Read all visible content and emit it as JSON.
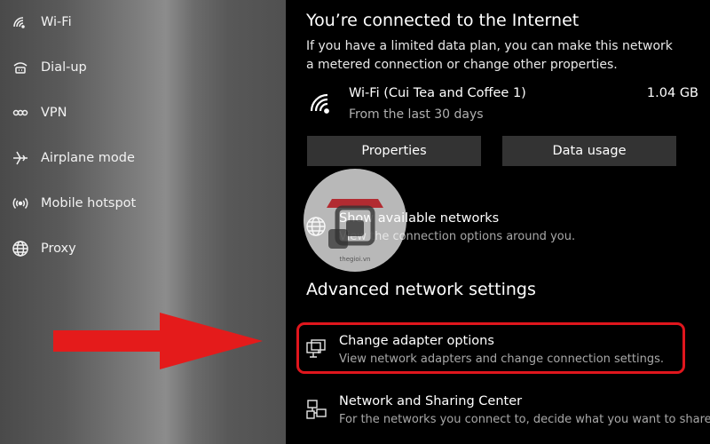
{
  "sidebar": {
    "items": [
      {
        "label": "Wi-Fi",
        "icon": "wifi-icon"
      },
      {
        "label": "Dial-up",
        "icon": "dialup-icon"
      },
      {
        "label": "VPN",
        "icon": "vpn-icon"
      },
      {
        "label": "Airplane mode",
        "icon": "airplane-icon"
      },
      {
        "label": "Mobile hotspot",
        "icon": "hotspot-icon"
      },
      {
        "label": "Proxy",
        "icon": "globe-icon"
      }
    ]
  },
  "main": {
    "status_title": "You’re connected to the Internet",
    "status_desc": "If you have a limited data plan, you can make this network a metered connection or change other properties.",
    "network": {
      "name": "Wi-Fi (Cui Tea and Coffee 1)",
      "period": "From the last 30 days",
      "usage": "1.04 GB"
    },
    "buttons": {
      "properties": "Properties",
      "data_usage": "Data usage"
    },
    "show_networks": {
      "title": "Show available networks",
      "subtitle": "View the connection options around you."
    },
    "advanced_title": "Advanced network settings",
    "change_adapter": {
      "title": "Change adapter options",
      "subtitle": "View network adapters and change connection settings."
    },
    "sharing_center": {
      "title": "Network and Sharing Center",
      "subtitle": "For the networks you connect to, decide what you want to share."
    }
  },
  "watermark": {
    "text": "thegioi.vn"
  },
  "colors": {
    "highlight": "#e0161d",
    "arrow": "#e41b1b",
    "button_bg": "#333333"
  }
}
